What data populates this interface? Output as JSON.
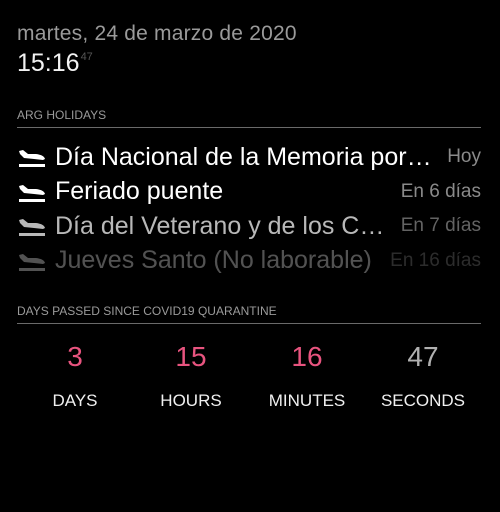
{
  "clock": {
    "date": "martes, 24 de marzo de 2020",
    "time": "15:16",
    "seconds": "47"
  },
  "holidays": {
    "header": "ARG HOLIDAYS",
    "events": [
      {
        "title": "Día Nacional de la Memoria por la Verdad y la Justicia",
        "when": "Hoy",
        "icon": "airplane-landing-icon"
      },
      {
        "title": "Feriado puente",
        "when": "En 6 días",
        "icon": "airplane-landing-icon"
      },
      {
        "title": "Día del Veterano y de los Caídos en la Guerra de Malvinas",
        "when": "En 7 días",
        "icon": "airplane-landing-icon"
      },
      {
        "title": "Jueves Santo (No laborable)",
        "when": "En 16 días",
        "icon": "airplane-landing-icon"
      }
    ]
  },
  "countdown": {
    "header": "DAYS PASSED SINCE COVID19 QUARANTINE",
    "units": [
      {
        "value": "3",
        "label": "DAYS"
      },
      {
        "value": "15",
        "label": "HOURS"
      },
      {
        "value": "16",
        "label": "MINUTES"
      },
      {
        "value": "47",
        "label": "SECONDS"
      }
    ],
    "accent_color": "#e8547f"
  }
}
